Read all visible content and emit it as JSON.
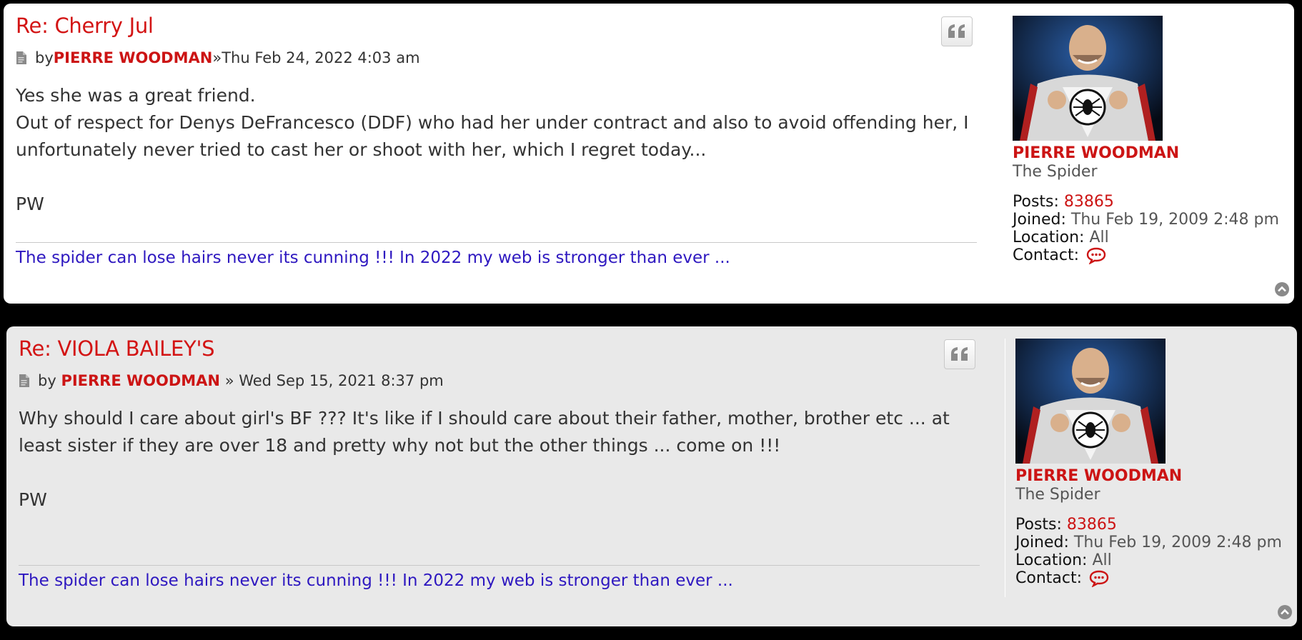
{
  "posts": [
    {
      "title": "Re: Cherry Jul",
      "by": "by",
      "author": "PIERRE WOODMAN",
      "sep": "»",
      "date": "Thu Feb 24, 2022 4:03 am",
      "content": [
        "Yes she was a great friend.",
        "Out of respect for Denys DeFrancesco (DDF) who had her under contract and also to avoid offending her, I unfortunately never tried to cast her or shoot with her, which I regret today...",
        "PW"
      ],
      "signature": "The spider can lose hairs never its cunning !!! In 2022 my web is stronger than ever ...",
      "quote_icon": "quote-icon",
      "profile": {
        "name": "PIERRE WOODMAN",
        "rank": "The Spider",
        "posts_label": "Posts:",
        "posts_value": "83865",
        "joined_label": "Joined:",
        "joined_value": "Thu Feb 19, 2009 2:48 pm",
        "location_label": "Location:",
        "location_value": "All",
        "contact_label": "Contact:",
        "contact_icon": "speech-bubble-icon"
      }
    },
    {
      "title": "Re: VIOLA BAILEY'S",
      "by": "by ",
      "author": "PIERRE WOODMAN",
      "sep": " » ",
      "date": "Wed Sep 15, 2021 8:37 pm",
      "content": [
        "Why should I care about girl's BF ??? It's like if I should care about their father, mother, brother etc ... at least sister if they are over 18 and pretty why not but the other things ... come on !!!",
        "PW"
      ],
      "signature": "The spider can lose hairs never its cunning !!! In 2022 my web is stronger than ever ...",
      "quote_icon": "quote-icon",
      "profile": {
        "name": "PIERRE WOODMAN",
        "rank": "The Spider",
        "posts_label": "Posts:",
        "posts_value": "83865",
        "joined_label": "Joined:",
        "joined_value": "Thu Feb 19, 2009 2:48 pm",
        "location_label": "Location:",
        "location_value": "All",
        "contact_label": "Contact:",
        "contact_icon": "speech-bubble-icon"
      }
    }
  ],
  "colors": {
    "title": "#d31414",
    "author": "#cc1414",
    "signature": "#2e18c0",
    "post1_bg": "#ffffff",
    "post2_bg": "#e9e9e9"
  }
}
